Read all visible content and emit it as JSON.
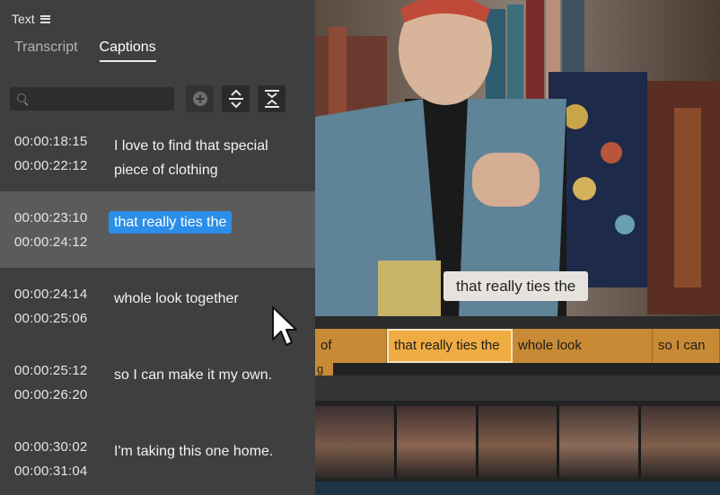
{
  "panel": {
    "title": "Text",
    "tabs": [
      {
        "label": "Transcript",
        "active": false
      },
      {
        "label": "Captions",
        "active": true
      }
    ],
    "search": {
      "placeholder": "",
      "value": ""
    },
    "tools": [
      {
        "name": "add-caption-button",
        "icon": "plus-circle-icon"
      },
      {
        "name": "split-caption-button",
        "icon": "split-icon"
      },
      {
        "name": "merge-caption-button",
        "icon": "merge-icon"
      }
    ]
  },
  "captions": [
    {
      "start": "00:00:18:15",
      "end": "00:00:22:12",
      "text": "I love to find that special piece of clothing",
      "selected": false
    },
    {
      "start": "00:00:23:10",
      "end": "00:00:24:12",
      "text": "that really ties the",
      "selected": true
    },
    {
      "start": "00:00:24:14",
      "end": "00:00:25:06",
      "text": "whole look together",
      "selected": false
    },
    {
      "start": "00:00:25:12",
      "end": "00:00:26:20",
      "text": "so I can make it my own.",
      "selected": false
    },
    {
      "start": "00:00:30:02",
      "end": "00:00:31:04",
      "text": "I'm taking this one home.",
      "selected": false
    }
  ],
  "video": {
    "caption_overlay": "that really ties the"
  },
  "timeline": {
    "clips": [
      {
        "label": "of",
        "selected": false
      },
      {
        "label": "that really ties the",
        "selected": true
      },
      {
        "label": "whole look",
        "selected": false
      },
      {
        "label": "so I can",
        "selected": false
      }
    ],
    "spill_text": "g"
  },
  "colors": {
    "highlight": "#2b8ee8",
    "clip": "#c88a34",
    "clip_selected": "#efac43",
    "panel_bg": "#3f3f3f",
    "row_selected": "#5b5b5b"
  }
}
